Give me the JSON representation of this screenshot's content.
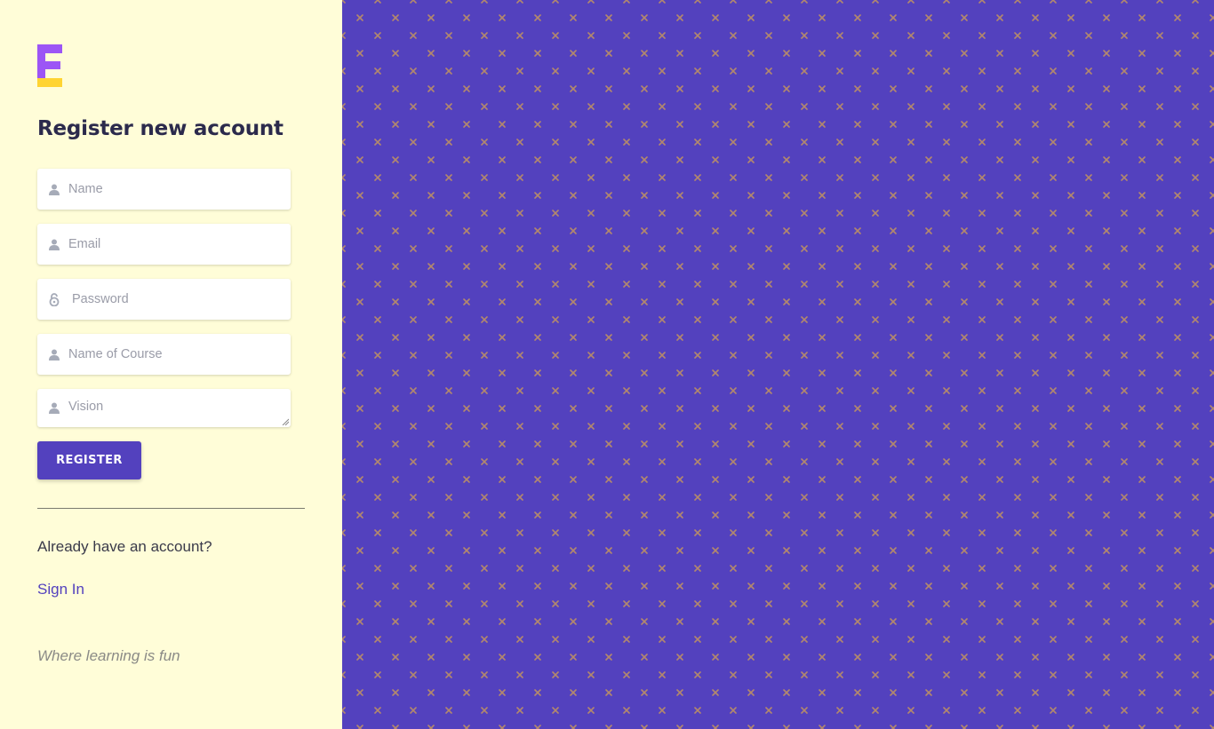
{
  "colors": {
    "panel_background": "#FFFDD8",
    "brand_purple": "#5341BE",
    "logo_purple": "#9C55F5",
    "logo_yellow": "#FFD432",
    "pattern_mark": "#B3886C"
  },
  "logo": {
    "icon": "brand-logo-icon"
  },
  "form": {
    "title": "Register new account",
    "fields": {
      "name": {
        "placeholder": "Name",
        "icon": "user-icon"
      },
      "email": {
        "placeholder": "Email",
        "icon": "user-icon"
      },
      "password": {
        "placeholder": "Password",
        "icon": "unlock-icon"
      },
      "course": {
        "placeholder": "Name of Course",
        "icon": "user-icon"
      },
      "vision": {
        "placeholder": "Vision",
        "icon": "user-icon"
      }
    },
    "submit_label": "REGISTER"
  },
  "footer": {
    "already_text": "Already have an account?",
    "signin_label": "Sign In",
    "tagline": "Where learning is fun"
  }
}
